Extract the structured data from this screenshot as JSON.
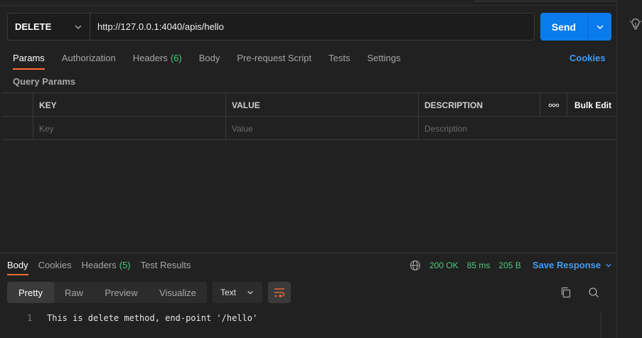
{
  "request": {
    "method": "DELETE",
    "url": "http://127.0.0.1:4040/apis/hello",
    "send_label": "Send"
  },
  "request_tabs": [
    {
      "label": "Params",
      "active": true
    },
    {
      "label": "Authorization"
    },
    {
      "label": "Headers",
      "count": "(6)"
    },
    {
      "label": "Body"
    },
    {
      "label": "Pre-request Script"
    },
    {
      "label": "Tests"
    },
    {
      "label": "Settings"
    }
  ],
  "cookies_label": "Cookies",
  "query_params": {
    "title": "Query Params",
    "headers": {
      "key": "KEY",
      "value": "VALUE",
      "description": "DESCRIPTION",
      "bulk_edit": "Bulk Edit"
    },
    "placeholders": {
      "key": "Key",
      "value": "Value",
      "description": "Description"
    }
  },
  "response": {
    "tabs": [
      {
        "label": "Body",
        "active": true
      },
      {
        "label": "Cookies"
      },
      {
        "label": "Headers",
        "count": "(5)"
      },
      {
        "label": "Test Results"
      }
    ],
    "status": "200 OK",
    "time": "85 ms",
    "size": "205 B",
    "save_label": "Save Response",
    "view_modes": [
      "Pretty",
      "Raw",
      "Preview",
      "Visualize"
    ],
    "active_view": "Pretty",
    "format": "Text",
    "line_number": "1",
    "body_text": "This is delete method, end-point '/hello'"
  },
  "colors": {
    "accent_orange": "#ff6c37",
    "send_blue": "#097bed",
    "link_blue": "#3d9cfa",
    "status_green": "#4ec97f",
    "background": "#212121"
  },
  "icons": [
    "lightbulb-icon",
    "chevron-down-icon",
    "more-horizontal-icon",
    "globe-icon",
    "wrap-lines-icon",
    "copy-icon",
    "search-icon"
  ]
}
